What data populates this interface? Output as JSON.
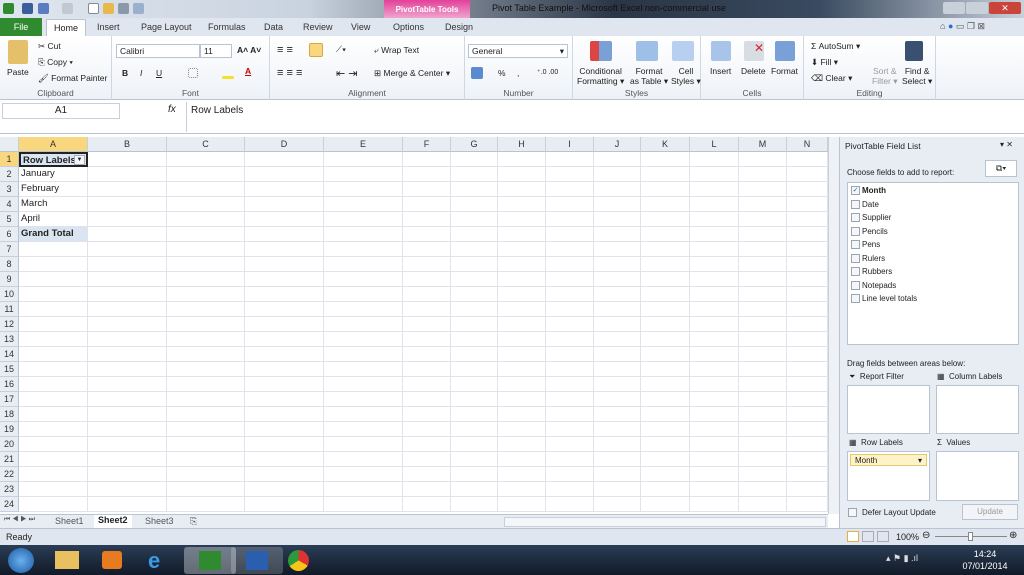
{
  "window": {
    "title": "Pivot Table Example  -  Microsoft Excel non-commercial use",
    "context_tab": "PivotTable Tools"
  },
  "tabs": {
    "file": "File",
    "home": "Home",
    "items": [
      "Insert",
      "Page Layout",
      "Formulas",
      "Data",
      "Review",
      "View",
      "Options",
      "Design"
    ]
  },
  "ribbon": {
    "clipboard": {
      "paste": "Paste",
      "cut": "Cut",
      "copy": "Copy",
      "format_painter": "Format Painter",
      "label": "Clipboard"
    },
    "font": {
      "name": "Calibri",
      "size": "11",
      "label": "Font",
      "bold": "B",
      "italic": "I",
      "underline": "U"
    },
    "alignment": {
      "wrap": "Wrap Text",
      "merge": "Merge & Center",
      "label": "Alignment"
    },
    "number": {
      "format": "General",
      "percent": "%",
      "comma": ",",
      "label": "Number"
    },
    "styles": {
      "conditional": "Conditional",
      "conditional2": "Formatting",
      "format_table": "Format",
      "format_table2": "as Table",
      "cell_styles": "Cell",
      "cell_styles2": "Styles",
      "label": "Styles"
    },
    "cells": {
      "insert": "Insert",
      "delete": "Delete",
      "format": "Format",
      "label": "Cells"
    },
    "editing": {
      "autosum": "AutoSum",
      "fill": "Fill",
      "clear": "Clear",
      "sort": "Sort &",
      "sort2": "Filter",
      "find": "Find &",
      "find2": "Select",
      "label": "Editing"
    }
  },
  "formula_bar": {
    "name_box": "A1",
    "fx": "fx",
    "value": "Row Labels"
  },
  "sheet": {
    "columns": [
      "A",
      "B",
      "C",
      "D",
      "E",
      "F",
      "G",
      "H",
      "I",
      "J",
      "K",
      "L",
      "M",
      "N"
    ],
    "rows": [
      "1",
      "2",
      "3",
      "4",
      "5",
      "6",
      "7",
      "8",
      "9",
      "10",
      "11",
      "12",
      "13",
      "14",
      "15",
      "16",
      "17",
      "18",
      "19",
      "20",
      "21",
      "22",
      "23",
      "24"
    ],
    "cells": [
      "Row Labels",
      "January",
      "February",
      "March",
      "April",
      "Grand Total"
    ],
    "selected": "A1"
  },
  "sheet_tabs": [
    "Sheet1",
    "Sheet2",
    "Sheet3"
  ],
  "active_sheet": "Sheet2",
  "field_list": {
    "title": "PivotTable Field List",
    "choose": "Choose fields to add to report:",
    "fields": [
      {
        "name": "Month",
        "checked": true
      },
      {
        "name": "Date",
        "checked": false
      },
      {
        "name": "Supplier",
        "checked": false
      },
      {
        "name": "Pencils",
        "checked": false
      },
      {
        "name": "Pens",
        "checked": false
      },
      {
        "name": "Rulers",
        "checked": false
      },
      {
        "name": "Rubbers",
        "checked": false
      },
      {
        "name": "Notepads",
        "checked": false
      },
      {
        "name": "Line level totals",
        "checked": false
      }
    ],
    "drag": "Drag fields between areas below:",
    "report_filter": "Report Filter",
    "column_labels": "Column Labels",
    "row_labels": "Row Labels",
    "values": "Values",
    "row_field": "Month",
    "defer": "Defer Layout Update",
    "update": "Update"
  },
  "status": {
    "text": "Ready",
    "zoom": "100%"
  },
  "taskbar": {
    "time": "14:24",
    "date": "07/01/2014"
  },
  "colors": {
    "file_tab": "#2f8a30",
    "context": "#e2409a",
    "selected_header": "#f9d77e",
    "pivot_header": "#dbe5f1"
  }
}
